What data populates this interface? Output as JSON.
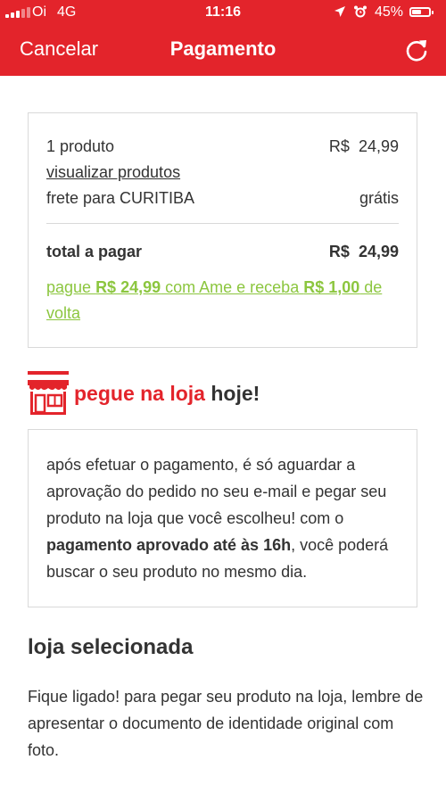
{
  "status": {
    "carrier": "Oi",
    "network": "4G",
    "time": "11:16",
    "battery": "45%"
  },
  "nav": {
    "cancel_label": "Cancelar",
    "title": "Pagamento"
  },
  "summary": {
    "products_label": "1 produto",
    "currency": "R$",
    "products_value": "24,99",
    "view_products_link": "visualizar produtos",
    "shipping_label": "frete para CURITIBA",
    "shipping_value": "grátis",
    "total_label": "total a pagar",
    "total_value": "24,99",
    "ame": {
      "part1": "pague ",
      "amount": "R$ 24,99",
      "part2": " com Ame e receba ",
      "cashback": "R$ 1,00",
      "part3": " de volta"
    }
  },
  "pickup": {
    "title_red": "pegue na loja",
    "title_dark": "hoje!",
    "text_part1": "após efetuar o pagamento, é só aguardar a aprovação do pedido no seu e-mail e pegar seu produto na loja que você escolheu! com o ",
    "text_bold": "pagamento aprovado até às 16h",
    "text_part2": ", você poderá buscar o seu produto no mesmo dia."
  },
  "selected_store": {
    "title": "loja selecionada",
    "text": "Fique ligado! para pegar seu produto na loja, lembre de apresentar o documento de identidade original com foto."
  },
  "colors": {
    "brand_red": "#e3242b",
    "ame_green": "#8cc63f"
  },
  "icons": {
    "refresh": "refresh-icon",
    "store": "store-icon",
    "location": "location-arrow-icon",
    "alarm": "alarm-clock-icon"
  }
}
